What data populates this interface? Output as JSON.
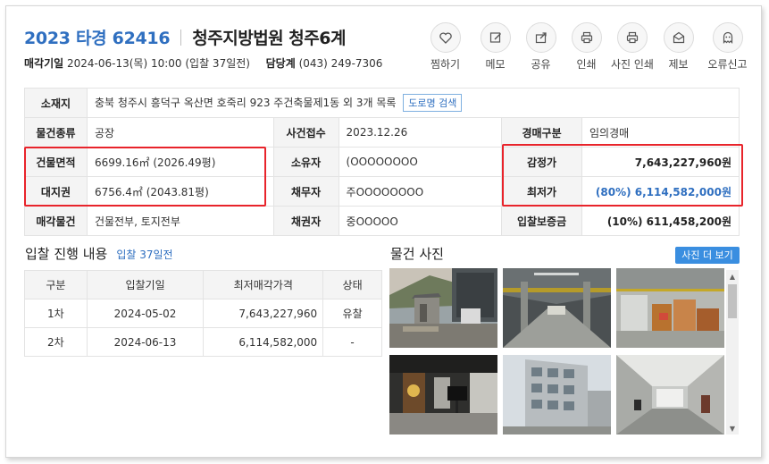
{
  "header": {
    "case_no": "2023 타경 62416",
    "court": "청주지방법원 청주6계",
    "sale_date_label": "매각기일",
    "sale_date_value": "2024-06-13(목) 10:00 (입찰 37일전)",
    "dept_label": "담당계",
    "dept_phone": "(043) 249-7306"
  },
  "actions": [
    {
      "label": "찜하기",
      "icon": "heart-icon"
    },
    {
      "label": "메모",
      "icon": "pencil-icon"
    },
    {
      "label": "공유",
      "icon": "share-icon"
    },
    {
      "label": "인쇄",
      "icon": "printer-icon"
    },
    {
      "label": "사진 인쇄",
      "icon": "photo-print-icon"
    },
    {
      "label": "제보",
      "icon": "envelope-icon"
    },
    {
      "label": "오류신고",
      "icon": "ghost-icon"
    }
  ],
  "info": {
    "location_label": "소재지",
    "location_value": "충북 청주시 흥덕구 옥산면 호죽리 923 주건축물제1동 외 3개 목록",
    "road_button": "도로명 검색",
    "type_label": "물건종류",
    "type_value": "공장",
    "case_receipt_label": "사건접수",
    "case_receipt_value": "2023.12.26",
    "auction_type_label": "경매구분",
    "auction_type_value": "임의경매",
    "building_area_label": "건물면적",
    "building_area_value": "6699.16㎡ (2026.49평)",
    "owner_label": "소유자",
    "owner_value": "(OOOOOOOO",
    "appraisal_label": "감정가",
    "appraisal_value": "7,643,227,960원",
    "land_label": "대지권",
    "land_value": "6756.4㎡ (2043.81평)",
    "debtor_label": "채무자",
    "debtor_value": "주OOOOOOOO",
    "min_price_label": "최저가",
    "min_price_value": "(80%) 6,114,582,000원",
    "sale_items_label": "매각물건",
    "sale_items_value": "건물전부, 토지전부",
    "creditor_label": "채권자",
    "creditor_value": "중OOOOO",
    "deposit_label": "입찰보증금",
    "deposit_value": "(10%) 611,458,200원"
  },
  "bidding": {
    "title": "입찰 진행 내용",
    "subtitle": "입찰 37일전",
    "columns": [
      "구분",
      "입찰기일",
      "최저매각가격",
      "상태"
    ],
    "rows": [
      [
        "1차",
        "2024-05-02",
        "7,643,227,960",
        "유찰"
      ],
      [
        "2차",
        "2024-06-13",
        "6,114,582,000",
        "-"
      ]
    ]
  },
  "photos": {
    "title": "물건 사진",
    "more_button": "사진 더 보기"
  },
  "colors": {
    "accent_blue": "#2f6fc0",
    "highlight_red": "#e8242b",
    "button_blue": "#3a8ee0"
  }
}
